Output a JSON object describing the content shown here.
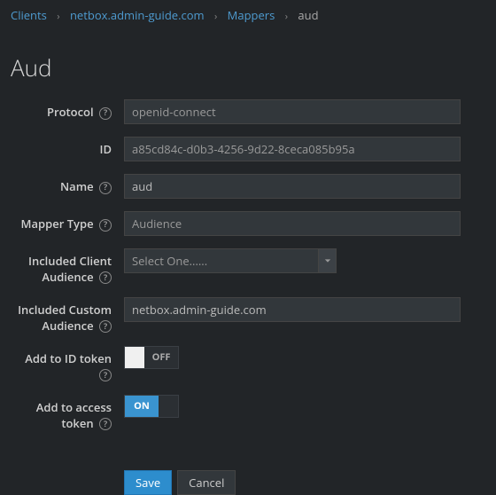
{
  "breadcrumb": {
    "items": [
      "Clients",
      "netbox.admin-guide.com",
      "Mappers"
    ],
    "current": "aud"
  },
  "page_title": "Aud",
  "form": {
    "protocol": {
      "label": "Protocol",
      "value": "openid-connect"
    },
    "id": {
      "label": "ID",
      "value": "a85cd84c-d0b3-4256-9d22-8ceca085b95a"
    },
    "name": {
      "label": "Name",
      "value": "aud"
    },
    "mapper_type": {
      "label": "Mapper Type",
      "value": "Audience"
    },
    "included_client_audience": {
      "label": "Included Client Audience",
      "placeholder": "Select One......"
    },
    "included_custom_audience": {
      "label": "Included Custom Audience",
      "value": "netbox.admin-guide.com"
    },
    "add_to_id_token": {
      "label": "Add to ID token",
      "off_text": "OFF"
    },
    "add_to_access_token": {
      "label": "Add to access token",
      "on_text": "ON"
    }
  },
  "buttons": {
    "save": "Save",
    "cancel": "Cancel"
  }
}
